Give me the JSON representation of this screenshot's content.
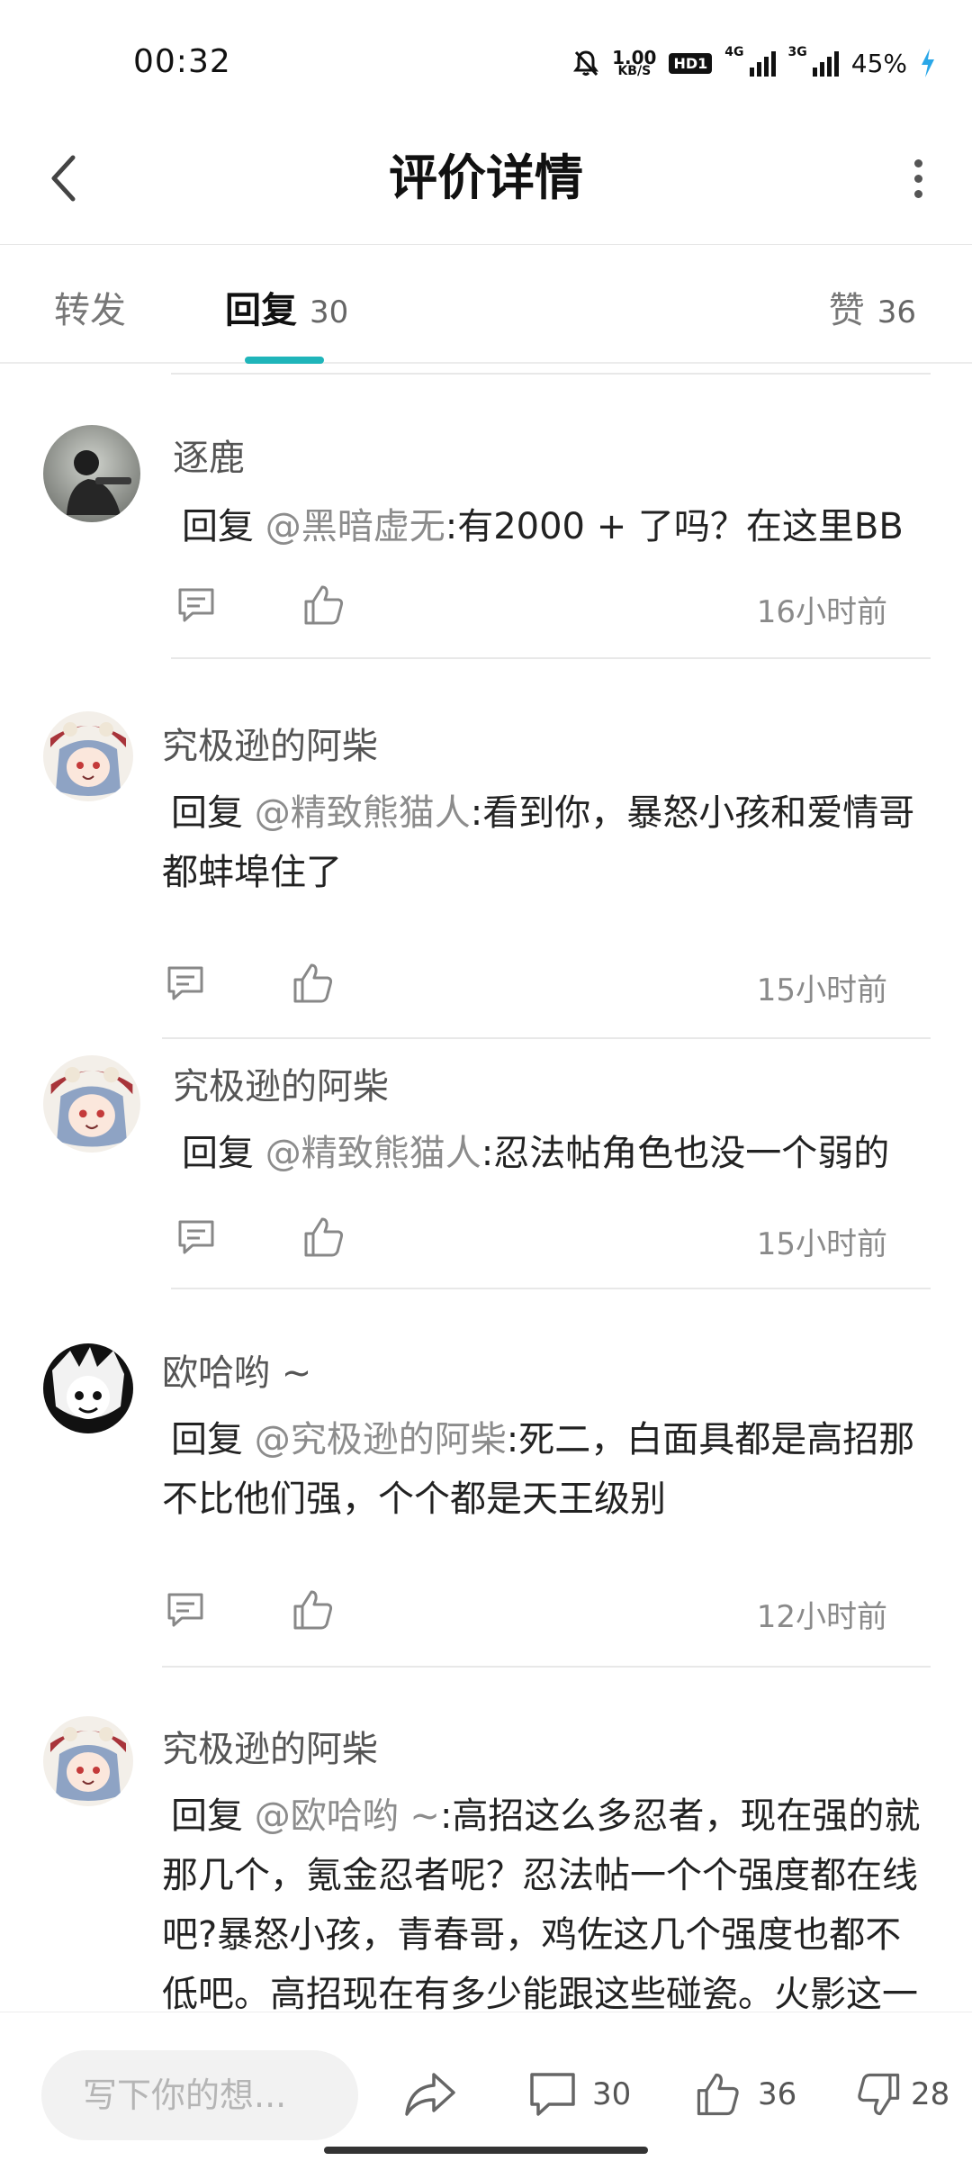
{
  "status_bar": {
    "time": "00:32",
    "speed_value": "1.00",
    "speed_unit": "KB/S",
    "hd_badge": "HD1",
    "net_1": "4G",
    "net_2": "3G",
    "battery": "45%"
  },
  "header": {
    "title": "评价详情"
  },
  "tabs": {
    "repost_label": "转发",
    "reply_label": "回复",
    "reply_count": "30",
    "like_label": "赞",
    "like_count": "36"
  },
  "replies": [
    {
      "user": "逐鹿",
      "prefix": "回复 ",
      "mention": "@黑暗虚无",
      "text": ":有2000 + 了吗？在这里BB",
      "time": "16小时前",
      "avatar_icon": "rider-photo"
    },
    {
      "user": "究极逊的阿柴",
      "prefix": "回复 ",
      "mention": "@精致熊猫人",
      "text": ":看到你，暴怒小孩和爱情哥都蚌埠住了",
      "time": "15小时前",
      "avatar_icon": "anime-girl-avatar"
    },
    {
      "user": "究极逊的阿柴",
      "prefix": "回复 ",
      "mention": "@精致熊猫人",
      "text": ":忍法帖角色也没一个弱的",
      "time": "15小时前",
      "avatar_icon": "anime-girl-avatar"
    },
    {
      "user": "欧哈哟 ~",
      "prefix": "回复 ",
      "mention": "@究极逊的阿柴",
      "text": ":死二，白面具都是高招那不比他们强，个个都是天王级别",
      "time": "12小时前",
      "avatar_icon": "manga-boy-avatar"
    },
    {
      "user": "究极逊的阿柴",
      "prefix": "回复 ",
      "mention": "@欧哈哟 ~",
      "text": ":高招这么多忍者，现在强的就那几个，氪金忍者呢？忍法帖一个个强度都在线吧?暴怒小孩，青春哥，鸡佐这几个强度也都不低吧。高招现在有多少能跟这些碰瓷。火影这一年多强度失衡你不会真看不出来吧",
      "time": "",
      "avatar_icon": "anime-girl-avatar"
    }
  ],
  "bottom_bar": {
    "input_placeholder": "写下你的想...",
    "comment_count": "30",
    "like_count": "36",
    "dislike_count": "28"
  },
  "colors": {
    "accent": "#1fb5ba",
    "mention": "#8c8c8c",
    "muted_text": "#8a8a8a"
  }
}
